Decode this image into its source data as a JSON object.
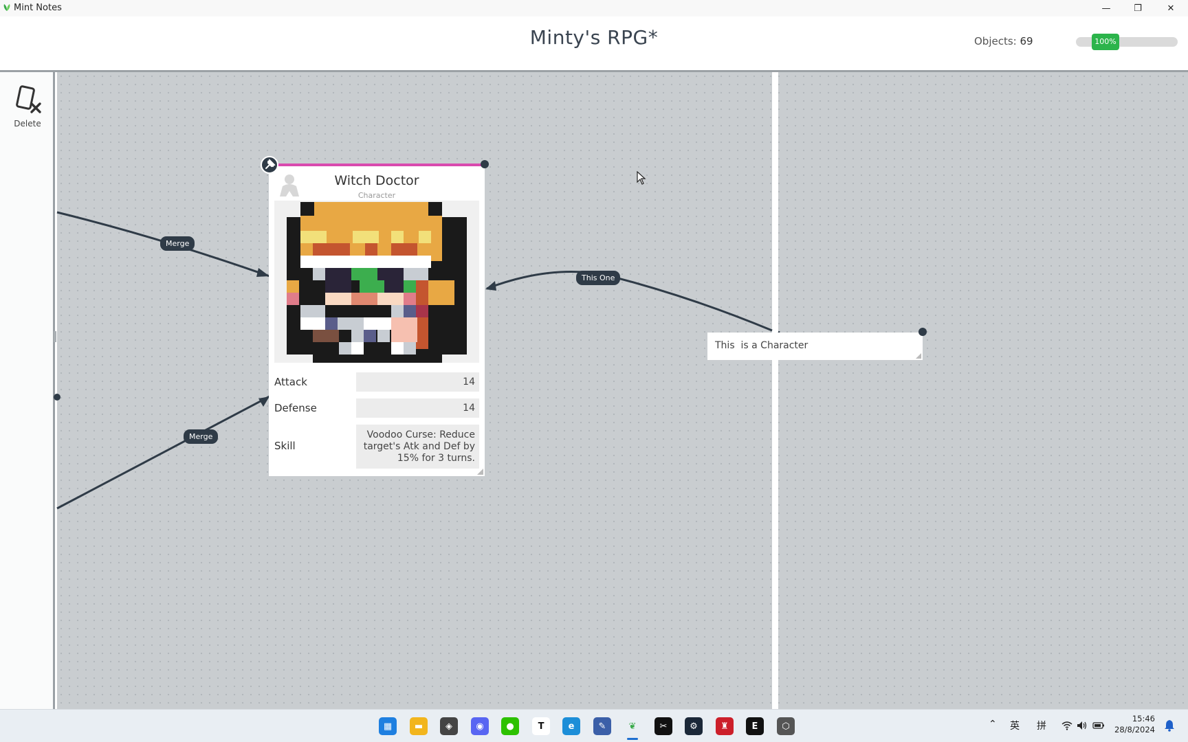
{
  "window": {
    "app_title": "Mint Notes",
    "minimize": "—",
    "restore": "❐",
    "close": "✕"
  },
  "header": {
    "doc_title": "Minty's RPG*",
    "objects_label": "Objects:",
    "objects_count": "69",
    "zoom": "100%"
  },
  "sidebar": {
    "delete_label": "Delete"
  },
  "canvas": {
    "edges": [
      {
        "label": "Merge"
      },
      {
        "label": "Merge"
      },
      {
        "label": "This One"
      }
    ]
  },
  "card": {
    "title": "Witch Doctor",
    "type": "Character",
    "accent": "#d94aae",
    "stats": [
      {
        "label": "Attack",
        "value": "14"
      },
      {
        "label": "Defense",
        "value": "14"
      },
      {
        "label": "Skill",
        "value": "Voodoo Curse: Reduce target's Atk and Def by 15% for 3 turns."
      }
    ]
  },
  "note": {
    "text": "This  is a Character"
  },
  "taskbar": {
    "apps": [
      "windows-start-icon",
      "file-explorer-icon",
      "unity-icon",
      "discord-icon",
      "wechat-icon",
      "typora-icon",
      "edge-icon",
      "paint-icon",
      "mint-notes-icon",
      "capcut-icon",
      "steam-icon",
      "game-icon",
      "epic-games-icon",
      "unity-hub-icon"
    ],
    "tray": {
      "input_en": "英",
      "input_pinyin": "拼"
    },
    "clock": {
      "time": "15:46",
      "date": "28/8/2024"
    }
  }
}
